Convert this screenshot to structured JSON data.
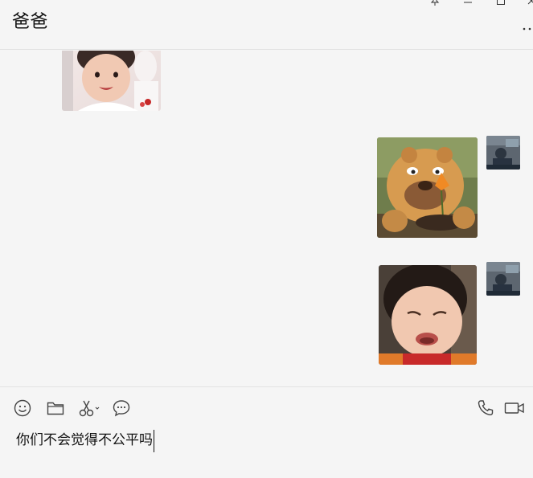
{
  "header": {
    "title": "爸爸",
    "controls": [
      "pin-icon",
      "minimize-icon",
      "maximize-icon",
      "close-icon"
    ],
    "more_icon": "more-icon"
  },
  "messages": [
    {
      "side": "left",
      "type": "image",
      "description_icon": "baby-smiling-photo"
    },
    {
      "side": "right",
      "type": "image",
      "description_icon": "cartoon-bear-sticker",
      "avatar": "sender-avatar"
    },
    {
      "side": "right",
      "type": "image",
      "description_icon": "crying-baby-sticker",
      "avatar": "sender-avatar"
    }
  ],
  "toolbar": {
    "left": [
      "emoji-icon",
      "folder-icon",
      "scissors-icon",
      "chat-bubble-icon"
    ],
    "right": [
      "phone-icon",
      "video-icon"
    ]
  },
  "input": {
    "value": "你们不会觉得不公平吗"
  },
  "colors": {
    "background": "#f5f5f5",
    "divider": "#e2e2e2",
    "icon": "#555555"
  }
}
